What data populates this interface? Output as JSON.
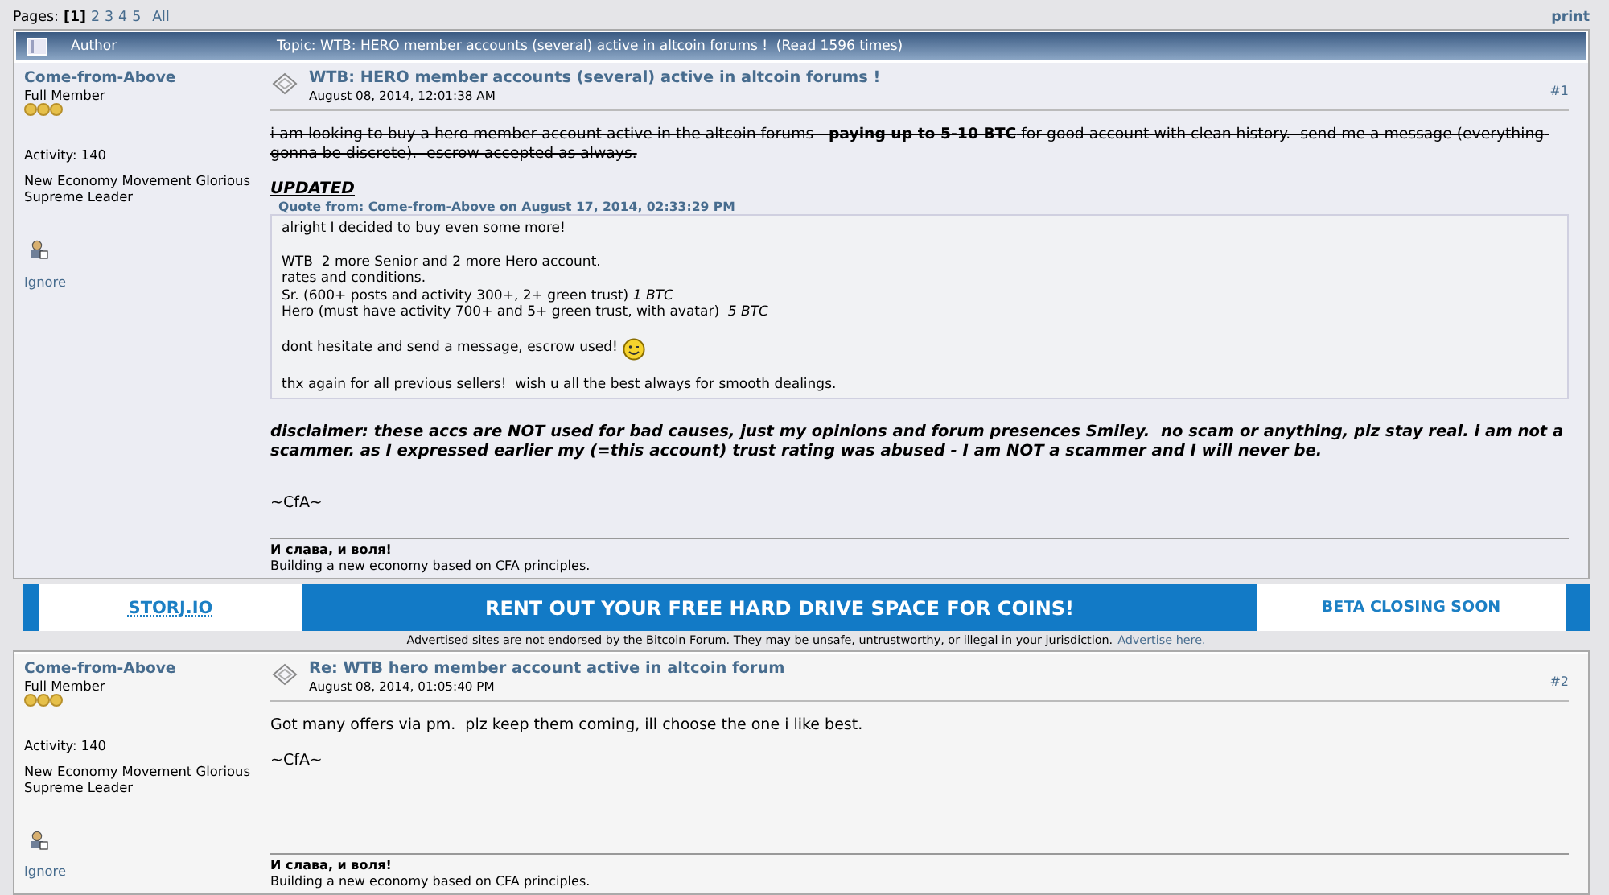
{
  "pagination": {
    "label": "Pages:",
    "pages": [
      {
        "label": "[1]",
        "selected": true
      },
      {
        "label": "2",
        "selected": false
      },
      {
        "label": "3",
        "selected": false
      },
      {
        "label": "4",
        "selected": false
      },
      {
        "label": "5",
        "selected": false
      }
    ],
    "all": "All",
    "print": "print"
  },
  "header": {
    "author": "Author",
    "topic": "Topic: WTB: HERO member accounts (several) active in altcoin forums !  (Read 1596 times)"
  },
  "posts": [
    {
      "author": "Come-from-Above",
      "rank": "Full Member",
      "stars": 3,
      "activity": "Activity: 140",
      "custom_title": "New Economy Movement Glorious Supreme Leader",
      "ignore": "Ignore",
      "subject": "WTB: HERO member accounts (several) active in altcoin forums !",
      "date": "August 08, 2014, 12:01:38 AM",
      "number": "#1",
      "blocks": [
        {
          "kind": "struck",
          "text": "i am looking to buy a hero member account active in the altcoin forums-  **paying up to 5-10 BTC** for good account with clean history.  send me a message (everything gonna be discrete).  escrow accepted as always."
        },
        {
          "kind": "heading",
          "text": "UPDATED"
        },
        {
          "kind": "quote",
          "header": "Quote from: Come-from-Above on August 17, 2014, 02:33:29 PM",
          "paragraphs": [
            {
              "lines": [
                "alright I decided to buy even some more!"
              ],
              "smiley": false
            },
            {
              "lines": [
                "WTB  2 more Senior and 2 more Hero account.",
                "rates and conditions.",
                "Sr. (600+ posts and activity 300+, 2+ green trust) *1 BTC*",
                "Hero (must have activity 700+ and 5+ green trust, with avatar)  *5 BTC*"
              ],
              "smiley": false
            },
            {
              "lines": [
                "dont hesitate and send a message, escrow used!"
              ],
              "smiley": true
            },
            {
              "lines": [
                "thx again for all previous sellers!  wish u all the best always for smooth dealings."
              ],
              "smiley": false
            }
          ]
        },
        {
          "kind": "disclaimer",
          "text": "disclaimer: these accs are NOT used for bad causes, just my opinions and forum presences Smiley.  no scam or anything, plz stay real. i am not a scammer. as I expressed earlier my (=this account) trust rating was abused - I am NOT a scammer and I will never be."
        },
        {
          "kind": "plain",
          "text": "~CfA~"
        }
      ],
      "signature": {
        "title": "И слава, и воля!",
        "line": "Building a new economy based on CFA principles."
      }
    },
    {
      "author": "Come-from-Above",
      "rank": "Full Member",
      "stars": 3,
      "activity": "Activity: 140",
      "custom_title": "New Economy Movement Glorious Supreme Leader",
      "ignore": "Ignore",
      "subject": "Re: WTB hero member account active in altcoin forum",
      "date": "August 08, 2014, 01:05:40 PM",
      "number": "#2",
      "blocks": [
        {
          "kind": "plain",
          "text": "Got many offers via pm.  plz keep them coming, ill choose the one i like best."
        },
        {
          "kind": "plain",
          "text": "~CfA~"
        }
      ],
      "signature": {
        "title": "И слава, и воля!",
        "line": "Building a new economy based on CFA principles."
      }
    }
  ],
  "ad": {
    "left": "STORJ.IO",
    "middle": "RENT OUT YOUR FREE HARD DRIVE SPACE FOR COINS!",
    "right": "BETA CLOSING SOON",
    "notice": "Advertised sites are not endorsed by the Bitcoin Forum. They may be unsafe, untrustworthy, or illegal in your jurisdiction.",
    "link": "Advertise here."
  }
}
